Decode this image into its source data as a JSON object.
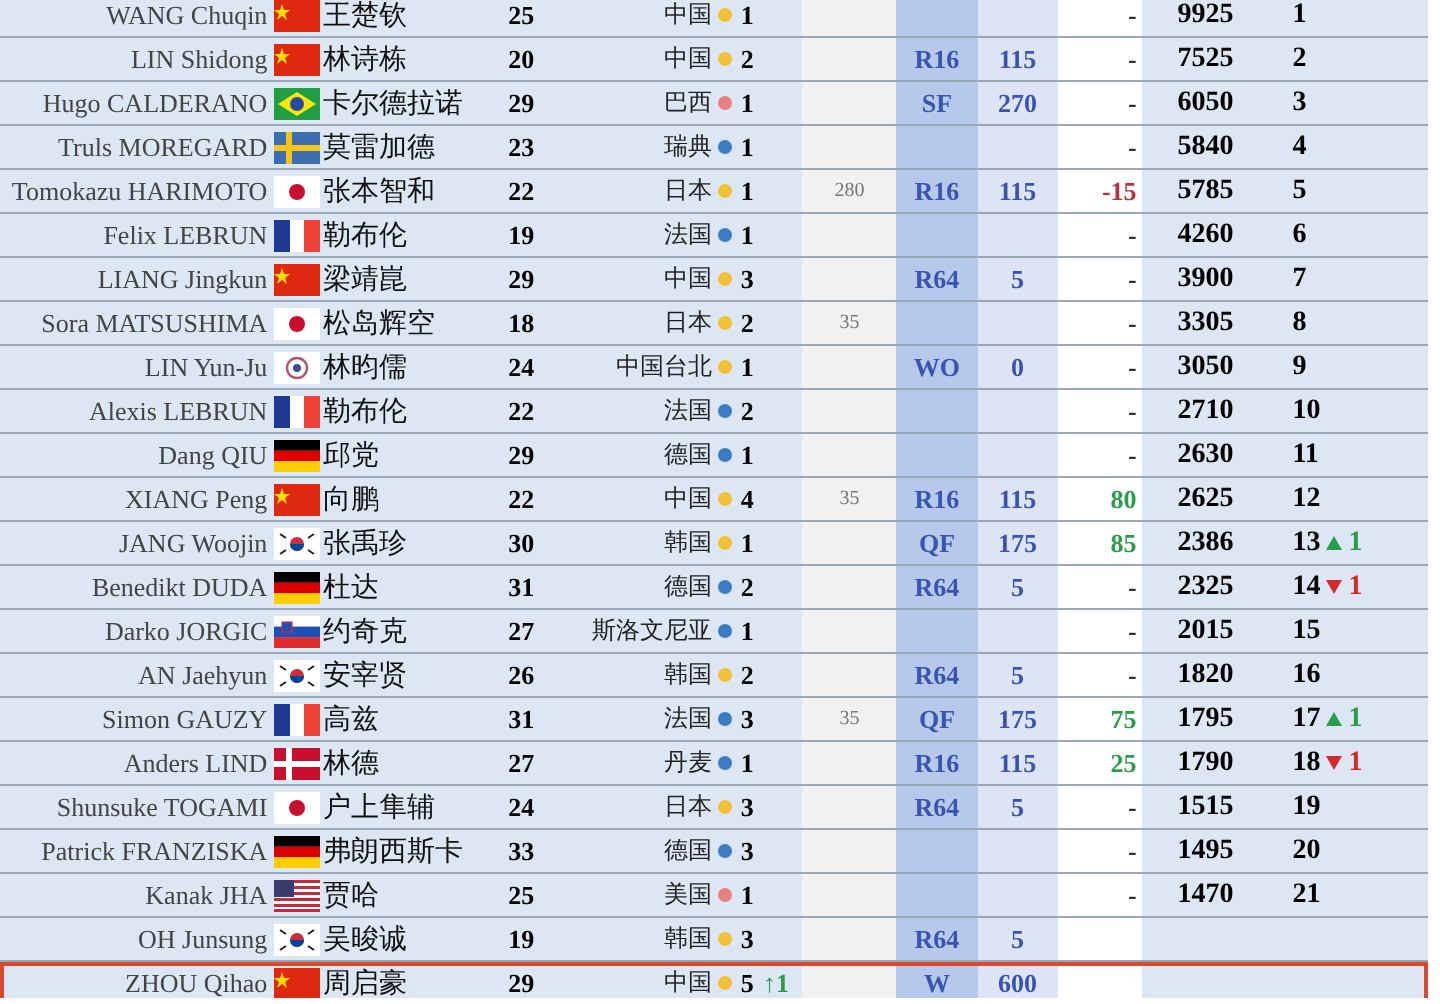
{
  "rows": [
    {
      "en": "WANG Chuqin",
      "flag": {
        "kind": "cn"
      },
      "cn": "王楚钦",
      "age": "25",
      "country": "中国",
      "color": "#f2c037",
      "count": "1",
      "change": {
        "kind": "none",
        "text": "-"
      },
      "total": "9925",
      "rank": "1",
      "highlighted": false
    },
    {
      "en": "LIN Shidong",
      "flag": {
        "kind": "cn"
      },
      "cn": "林诗栋",
      "age": "20",
      "country": "中国",
      "color": "#f2c037",
      "count": "2",
      "round": "R16",
      "points": "115",
      "change": {
        "kind": "none",
        "text": "-"
      },
      "total": "7525",
      "rank": "2",
      "highlighted": false
    },
    {
      "en": "Hugo CALDERANO",
      "flag": {
        "kind": "br"
      },
      "cn": "卡尔德拉诺",
      "age": "29",
      "country": "巴西",
      "color": "#e88080",
      "count": "1",
      "round": "SF",
      "points": "270",
      "change": {
        "kind": "none",
        "text": "-"
      },
      "total": "6050",
      "rank": "3",
      "highlighted": false
    },
    {
      "en": "Truls MOREGARD",
      "flag": {
        "kind": "se"
      },
      "cn": "莫雷加德",
      "age": "23",
      "country": "瑞典",
      "color": "#3b7cc4",
      "count": "1",
      "change": {
        "kind": "none",
        "text": "-"
      },
      "total": "5840",
      "rank": "4",
      "highlighted": false
    },
    {
      "en": "Tomokazu HARIMOTO",
      "flag": {
        "kind": "jp"
      },
      "cn": "张本智和",
      "age": "22",
      "country": "日本",
      "color": "#f2c037",
      "count": "1",
      "extra": "280",
      "round": "R16",
      "points": "115",
      "change": {
        "kind": "down",
        "text": "-15"
      },
      "total": "5785",
      "rank": "5",
      "highlighted": false
    },
    {
      "en": "Felix LEBRUN",
      "flag": {
        "kind": "fr"
      },
      "cn": "勒布伦",
      "age": "19",
      "country": "法国",
      "color": "#3b7cc4",
      "count": "1",
      "change": {
        "kind": "none",
        "text": "-"
      },
      "total": "4260",
      "rank": "6",
      "highlighted": false
    },
    {
      "en": "LIANG Jingkun",
      "flag": {
        "kind": "cn"
      },
      "cn": "梁靖崑",
      "age": "29",
      "country": "中国",
      "color": "#f2c037",
      "count": "3",
      "round": "R64",
      "points": "5",
      "change": {
        "kind": "none",
        "text": "-"
      },
      "total": "3900",
      "rank": "7",
      "highlighted": false
    },
    {
      "en": "Sora MATSUSHIMA",
      "flag": {
        "kind": "jp"
      },
      "cn": "松岛辉空",
      "age": "18",
      "country": "日本",
      "color": "#f2c037",
      "count": "2",
      "extra": "35",
      "change": {
        "kind": "none",
        "text": "-"
      },
      "total": "3305",
      "rank": "8",
      "highlighted": false
    },
    {
      "en": "LIN Yun-Ju",
      "flag": {
        "kind": "tpe"
      },
      "cn": "林昀儒",
      "age": "24",
      "country": "中国台北",
      "color": "#f2c037",
      "count": "1",
      "round": "WO",
      "points": "0",
      "change": {
        "kind": "none",
        "text": "-"
      },
      "total": "3050",
      "rank": "9",
      "highlighted": false
    },
    {
      "en": "Alexis LEBRUN",
      "flag": {
        "kind": "fr"
      },
      "cn": "勒布伦",
      "age": "22",
      "country": "法国",
      "color": "#3b7cc4",
      "count": "2",
      "change": {
        "kind": "none",
        "text": "-"
      },
      "total": "2710",
      "rank": "10",
      "highlighted": false
    },
    {
      "en": "Dang QIU",
      "flag": {
        "kind": "de"
      },
      "cn": "邱党",
      "age": "29",
      "country": "德国",
      "color": "#3b7cc4",
      "count": "1",
      "change": {
        "kind": "none",
        "text": "-"
      },
      "total": "2630",
      "rank": "11",
      "highlighted": false
    },
    {
      "en": "XIANG Peng",
      "flag": {
        "kind": "cn"
      },
      "cn": "向鹏",
      "age": "22",
      "country": "中国",
      "color": "#f2c037",
      "count": "4",
      "extra": "35",
      "round": "R16",
      "points": "115",
      "change": {
        "kind": "up",
        "text": "80"
      },
      "total": "2625",
      "rank": "12",
      "highlighted": false
    },
    {
      "en": "JANG Woojin",
      "flag": {
        "kind": "kr"
      },
      "cn": "张禹珍",
      "age": "30",
      "country": "韩国",
      "color": "#f2c037",
      "count": "1",
      "round": "QF",
      "points": "175",
      "change": {
        "kind": "up",
        "text": "85"
      },
      "total": "2386",
      "rank": "13",
      "move": {
        "kind": "up",
        "text": "1"
      },
      "highlighted": false
    },
    {
      "en": "Benedikt DUDA",
      "flag": {
        "kind": "de"
      },
      "cn": "杜达",
      "age": "31",
      "country": "德国",
      "color": "#3b7cc4",
      "count": "2",
      "round": "R64",
      "points": "5",
      "change": {
        "kind": "none",
        "text": "-"
      },
      "total": "2325",
      "rank": "14",
      "move": {
        "kind": "down",
        "text": "1"
      },
      "highlighted": false
    },
    {
      "en": "Darko JORGIC",
      "flag": {
        "kind": "si"
      },
      "cn": "约奇克",
      "age": "27",
      "country": "斯洛文尼亚",
      "color": "#3b7cc4",
      "count": "1",
      "change": {
        "kind": "none",
        "text": "-"
      },
      "total": "2015",
      "rank": "15",
      "highlighted": false
    },
    {
      "en": "AN Jaehyun",
      "flag": {
        "kind": "kr"
      },
      "cn": "安宰贤",
      "age": "26",
      "country": "韩国",
      "color": "#f2c037",
      "count": "2",
      "round": "R64",
      "points": "5",
      "change": {
        "kind": "none",
        "text": "-"
      },
      "total": "1820",
      "rank": "16",
      "highlighted": false
    },
    {
      "en": "Simon GAUZY",
      "flag": {
        "kind": "fr"
      },
      "cn": "高兹",
      "age": "31",
      "country": "法国",
      "color": "#3b7cc4",
      "count": "3",
      "extra": "35",
      "round": "QF",
      "points": "175",
      "change": {
        "kind": "up",
        "text": "75"
      },
      "total": "1795",
      "rank": "17",
      "move": {
        "kind": "up",
        "text": "1"
      },
      "highlighted": false
    },
    {
      "en": "Anders LIND",
      "flag": {
        "kind": "dk"
      },
      "cn": "林德",
      "age": "27",
      "country": "丹麦",
      "color": "#3b7cc4",
      "count": "1",
      "round": "R16",
      "points": "115",
      "change": {
        "kind": "up",
        "text": "25"
      },
      "total": "1790",
      "rank": "18",
      "move": {
        "kind": "down",
        "text": "1"
      },
      "highlighted": false
    },
    {
      "en": "Shunsuke TOGAMI",
      "flag": {
        "kind": "jp"
      },
      "cn": "户上隼辅",
      "age": "24",
      "country": "日本",
      "color": "#f2c037",
      "count": "3",
      "round": "R64",
      "points": "5",
      "change": {
        "kind": "none",
        "text": "-"
      },
      "total": "1515",
      "rank": "19",
      "highlighted": false
    },
    {
      "en": "Patrick FRANZISKA",
      "flag": {
        "kind": "de"
      },
      "cn": "弗朗西斯卡",
      "age": "33",
      "country": "德国",
      "color": "#3b7cc4",
      "count": "3",
      "change": {
        "kind": "none",
        "text": "-"
      },
      "total": "1495",
      "rank": "20",
      "highlighted": false
    },
    {
      "en": "Kanak JHA",
      "flag": {
        "kind": "us"
      },
      "cn": "贾哈",
      "age": "25",
      "country": "美国",
      "color": "#e88080",
      "count": "1",
      "change": {
        "kind": "none",
        "text": "-"
      },
      "total": "1470",
      "rank": "21",
      "highlighted": false
    },
    {
      "en": "OH Junsung",
      "flag": {
        "kind": "kr"
      },
      "cn": "吴晙诚",
      "age": "19",
      "country": "韩国",
      "color": "#f2c037",
      "count": "3",
      "round": "R64",
      "points": "5",
      "highlighted": false
    },
    {
      "en": "ZHOU Qihao",
      "flag": {
        "kind": "cn"
      },
      "cn": "周启豪",
      "age": "29",
      "country": "中国",
      "color": "#f2c037",
      "count": "5",
      "trend": "↑1",
      "round": "W",
      "points": "600",
      "highlighted": true
    }
  ]
}
